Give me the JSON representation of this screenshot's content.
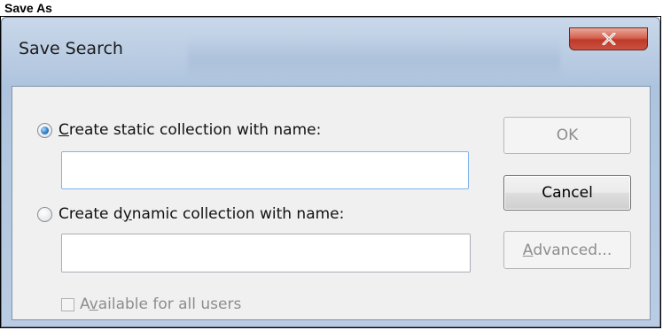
{
  "page_heading": "Save As",
  "dialog": {
    "title": "Save Search",
    "close_glyph": "x",
    "static_option": {
      "label_pre": "",
      "label_key": "C",
      "label_post": "reate static collection with name:",
      "selected": true
    },
    "static_name_value": "",
    "dynamic_option": {
      "label_pre": "Create d",
      "label_key": "y",
      "label_post": "namic collection with name:",
      "selected": false
    },
    "dynamic_name_value": "",
    "available_checkbox": {
      "label_pre": "A",
      "label_key": "v",
      "label_post": "ailable for all users",
      "checked": false,
      "enabled": false
    },
    "buttons": {
      "ok": "OK",
      "cancel": "Cancel",
      "advanced_key": "A",
      "advanced_rest": "dvanced..."
    }
  },
  "colors": {
    "frame_glass": "#b9cce3",
    "close_red": "#c0392b",
    "radio_selected": "#2f7fc8",
    "disabled_text": "#8d8d8d",
    "focus_border": "#7eb4ea"
  },
  "icons": {
    "close": "close-icon"
  }
}
